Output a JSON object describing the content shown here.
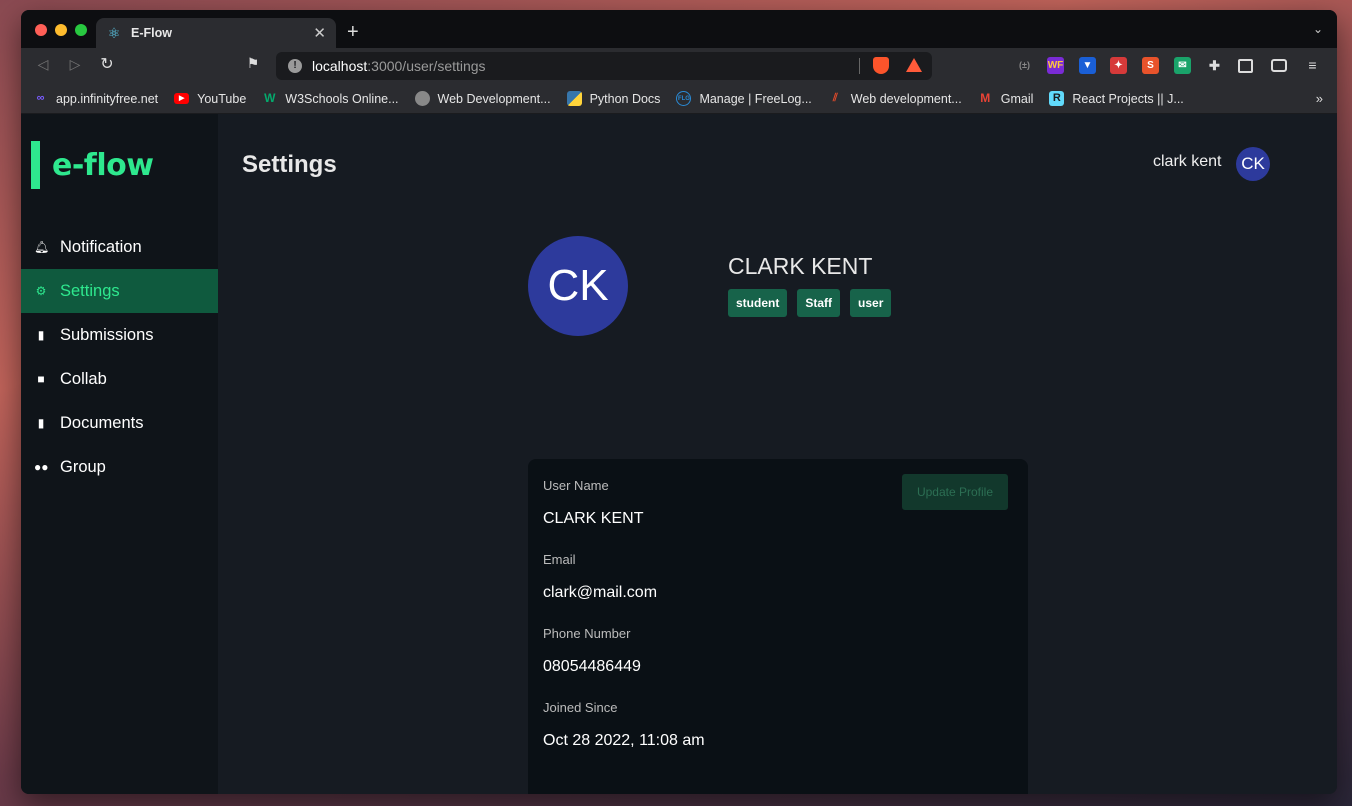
{
  "browser": {
    "tab": {
      "title": "E-Flow",
      "favicon": "react-icon"
    },
    "url": {
      "host": "localhost",
      "path": ":3000/user/settings"
    },
    "bookmarks": [
      {
        "label": "app.infinityfree.net",
        "icon": "infinity-icon",
        "color": "#7a5cff"
      },
      {
        "label": "YouTube",
        "icon": "youtube-icon",
        "color": "#ff0000"
      },
      {
        "label": "W3Schools Online...",
        "icon": "w3schools-icon",
        "color": "#04aa6d"
      },
      {
        "label": "Web Development...",
        "icon": "globe-icon",
        "color": "#888888"
      },
      {
        "label": "Python Docs",
        "icon": "python-icon",
        "color": "#3776ab"
      },
      {
        "label": "Manage | FreeLog...",
        "icon": "freelogo-icon",
        "color": "#2a8bd6"
      },
      {
        "label": "Web development...",
        "icon": "web-dev-icon",
        "color": "#e04a2a"
      },
      {
        "label": "Gmail",
        "icon": "gmail-icon",
        "color": "#ea4335"
      },
      {
        "label": "React Projects || J...",
        "icon": "react-projects-icon",
        "color": "#61dafb"
      }
    ]
  },
  "app": {
    "logo": "e-flow",
    "accent": "#2ee88e",
    "nav": [
      {
        "label": "Notification",
        "icon": "bell-icon",
        "active": false
      },
      {
        "label": "Settings",
        "icon": "gear-icon",
        "active": true
      },
      {
        "label": "Submissions",
        "icon": "file-icon",
        "active": false
      },
      {
        "label": "Collab",
        "icon": "video-icon",
        "active": false
      },
      {
        "label": "Documents",
        "icon": "file-icon",
        "active": false
      },
      {
        "label": "Group",
        "icon": "users-icon",
        "active": false
      }
    ],
    "page_title": "Settings",
    "top_user": {
      "name": "clark kent",
      "initials": "CK"
    }
  },
  "profile": {
    "initials": "CK",
    "name": "CLARK KENT",
    "roles": [
      "student",
      "Staff",
      "user"
    ],
    "update_button": "Update Profile",
    "fields": [
      {
        "label": "User Name",
        "value": "CLARK KENT"
      },
      {
        "label": "Email",
        "value": "clark@mail.com"
      },
      {
        "label": "Phone Number",
        "value": "08054486449"
      },
      {
        "label": "Joined Since",
        "value": "Oct 28 2022, 11:08 am"
      }
    ]
  }
}
